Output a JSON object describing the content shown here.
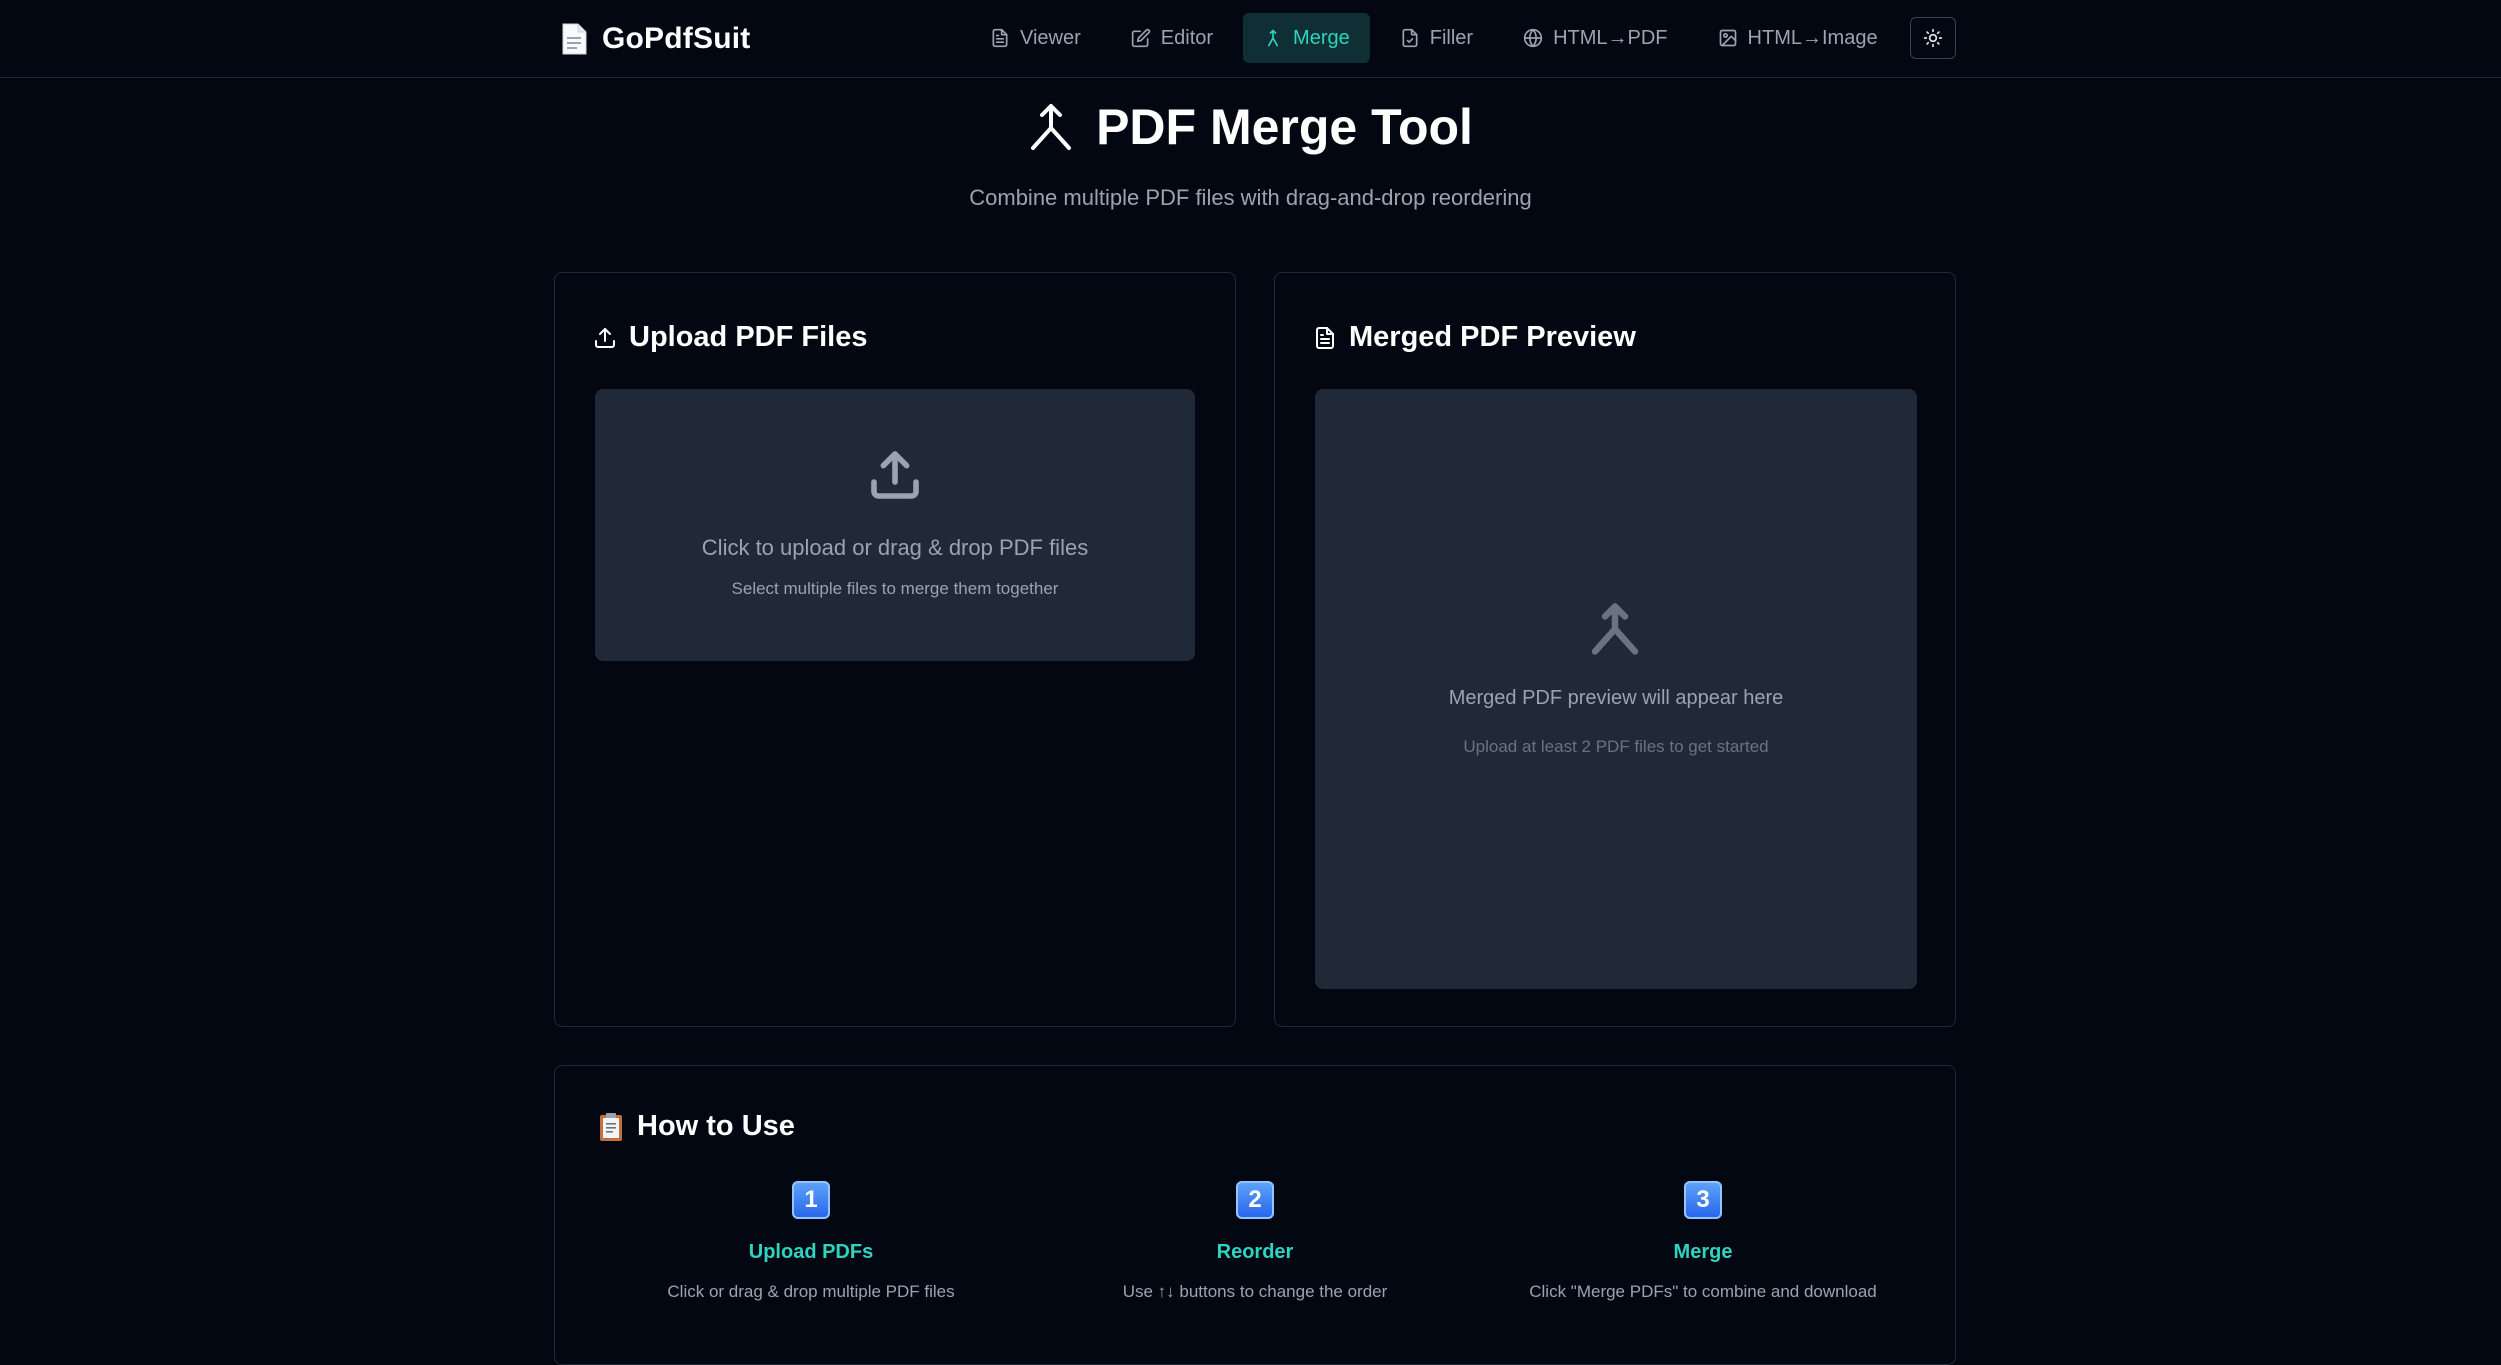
{
  "app": {
    "name": "GoPdfSuit"
  },
  "nav": {
    "items": [
      {
        "label": "Viewer",
        "icon": "file-text-icon",
        "active": false
      },
      {
        "label": "Editor",
        "icon": "edit-icon",
        "active": false
      },
      {
        "label": "Merge",
        "icon": "merge-icon",
        "active": true
      },
      {
        "label": "Filler",
        "icon": "file-check-icon",
        "active": false
      },
      {
        "label": "HTML→PDF",
        "icon": "globe-icon",
        "active": false
      },
      {
        "label": "HTML→Image",
        "icon": "image-icon",
        "active": false
      }
    ],
    "theme_toggle_icon": "sun-icon"
  },
  "hero": {
    "title": "PDF Merge Tool",
    "subtitle": "Combine multiple PDF files with drag-and-drop reordering"
  },
  "upload": {
    "title": "Upload PDF Files",
    "dropzone_main": "Click to upload or drag & drop PDF files",
    "dropzone_sub": "Select multiple files to merge them together"
  },
  "preview": {
    "title": "Merged PDF Preview",
    "empty_main": "Merged PDF preview will appear here",
    "empty_sub": "Upload at least 2 PDF files to get started"
  },
  "how_to": {
    "title": "How to Use",
    "steps": [
      {
        "badge": "1",
        "title": "Upload PDFs",
        "desc": "Click or drag & drop multiple PDF files"
      },
      {
        "badge": "2",
        "title": "Reorder",
        "desc": "Use ↑↓ buttons to change the order"
      },
      {
        "badge": "3",
        "title": "Merge",
        "desc": "Click \"Merge PDFs\" to combine and download"
      }
    ]
  },
  "colors": {
    "background": "#030712",
    "accent": "#2dd4bf",
    "panel": "#1f2937",
    "border": "#1f2937"
  }
}
